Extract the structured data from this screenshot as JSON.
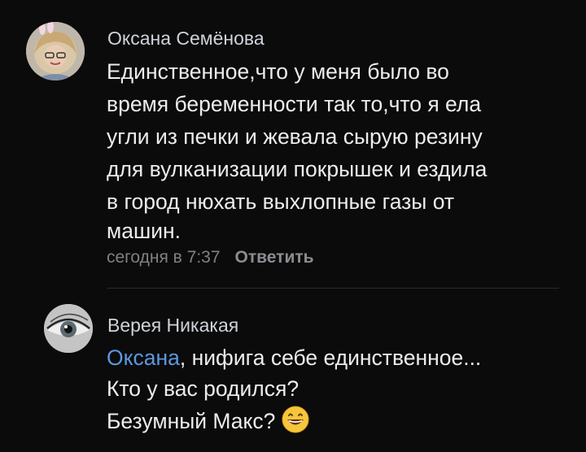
{
  "comments": [
    {
      "author": "Оксана Семёнова",
      "lines": [
        "Единственное,что у меня было во",
        "время беременности так то,что я ела",
        "угли из печки и жевала сырую резину",
        "для вулканизации покрышек и ездила",
        "в город нюхать выхлопные газы от",
        "машин."
      ],
      "timestamp": "сегодня в 7:37",
      "reply_label": "Ответить"
    },
    {
      "author": "Верея Никакая",
      "mention": "Оксана",
      "line1_rest": ", нифига себе единственное...",
      "line2": "Кто у вас родился?",
      "line3": "Безумный Макс?",
      "emoji": "grinning-face-emoji"
    }
  ],
  "colors": {
    "background": "#0b0b0b",
    "mention": "#5b97e0",
    "meta": "#7f8185"
  }
}
